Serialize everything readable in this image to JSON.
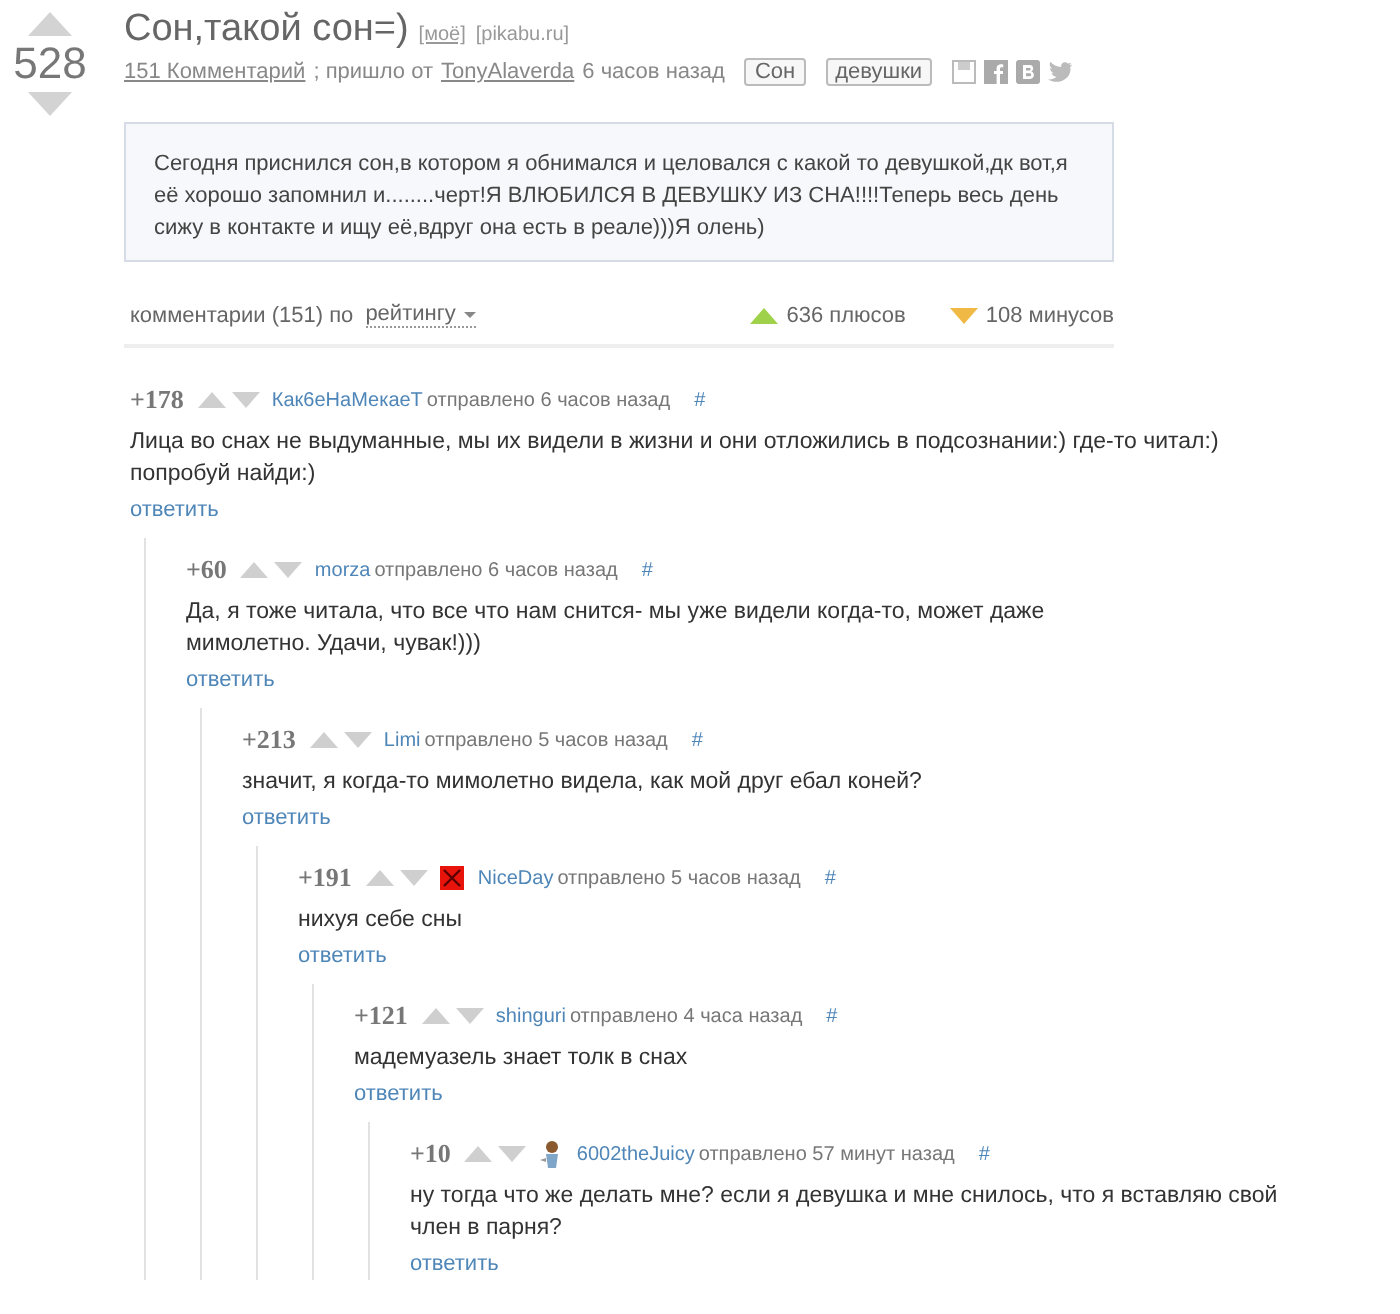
{
  "post": {
    "rating": "528",
    "title": "Сон,такой сон=)",
    "title_tags": [
      "[моё]",
      "[pikabu.ru]"
    ],
    "comments_link": "151 Комментарий",
    "from_text": "; пришло от",
    "author": "TonyAlaverda",
    "time": "6 часов назад",
    "tags": [
      "Сон",
      "девушки"
    ],
    "body": "Сегодня приснился сон,в котором я обнимался и целовался с какой то девушкой,дк вот,я её хорошо запомнил и........черт!Я ВЛЮБИЛСЯ В ДЕВУШКУ ИЗ СНА!!!!Теперь весь день сижу в контакте и ищу её,вдруг она есть в реале)))Я олень)"
  },
  "comments_header": {
    "label": "комментарии (151) по",
    "sort": "рейтингу",
    "plus": "636 плюсов",
    "minus": "108 минусов"
  },
  "comments": [
    {
      "score": "+178",
      "user": "Как6еНаМекаеТ",
      "sent": "отправлено 6 часов назад",
      "anchor": "#",
      "text": "Лица во снах не выдуманные, мы их видели в жизни и они отложились в подсознании:) где-то читал:) попробуй найди:)",
      "reply": "ответить",
      "children": [
        {
          "score": "+60",
          "user": "morza",
          "sent": "отправлено 6 часов назад",
          "anchor": "#",
          "text": "Да, я тоже читала, что все что нам снится- мы уже видели когда-то, может даже мимолетно. Удачи, чувак!)))",
          "reply": "ответить",
          "children": [
            {
              "score": "+213",
              "user": "Limi",
              "sent": "отправлено 5 часов назад",
              "anchor": "#",
              "text": "значит, я когда-то мимолетно видела, как мой друг ебал коней?",
              "reply": "ответить",
              "children": [
                {
                  "score": "+191",
                  "avatar": {
                    "kind": "broken"
                  },
                  "user": "NiceDay",
                  "sent": "отправлено 5 часов назад",
                  "anchor": "#",
                  "text": "нихуя себе сны",
                  "reply": "ответить",
                  "children": [
                    {
                      "score": "+121",
                      "user": "shinguri",
                      "sent": "отправлено 4 часа назад",
                      "anchor": "#",
                      "text": "мадемуазель знает толк в снах",
                      "reply": "ответить",
                      "children": [
                        {
                          "score": "+10",
                          "avatar": {
                            "kind": "figure"
                          },
                          "user": "6002theJuicy",
                          "sent": "отправлено 57 минут назад",
                          "anchor": "#",
                          "text": "ну тогда что же делать мне? если я девушка и мне снилось, что я вставляю свой член в парня?",
                          "reply": "ответить"
                        }
                      ]
                    }
                  ]
                }
              ]
            }
          ]
        }
      ]
    }
  ]
}
